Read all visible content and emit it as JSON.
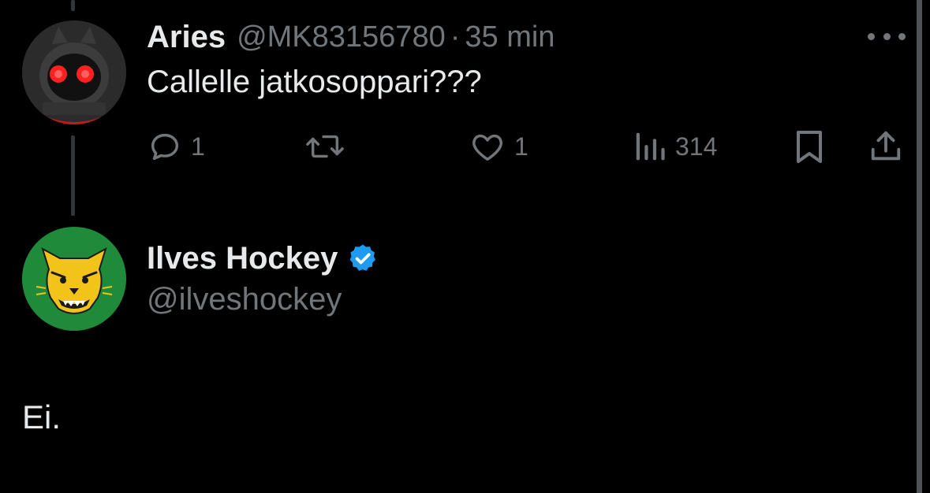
{
  "parent_tweet": {
    "display_name": "Aries",
    "handle": "@MK83156780",
    "separator": "·",
    "time": "35 min",
    "text": "Callelle jatkosoppari???",
    "actions": {
      "reply_count": "1",
      "retweet_count": "",
      "like_count": "1",
      "view_count": "314"
    }
  },
  "main_tweet": {
    "display_name": "Ilves Hockey",
    "handle": "@ilveshockey",
    "verified": true,
    "text": "Ei."
  },
  "colors": {
    "background": "#000000",
    "primary_text": "#e7e9ea",
    "secondary_text": "#71767b",
    "verified_blue": "#1d9bf0",
    "ilves_green": "#1e8a3a",
    "ilves_yellow": "#f2c318"
  },
  "icons": [
    "more-icon",
    "reply-icon",
    "retweet-icon",
    "like-icon",
    "views-icon",
    "bookmark-icon",
    "share-icon",
    "verified-icon"
  ]
}
